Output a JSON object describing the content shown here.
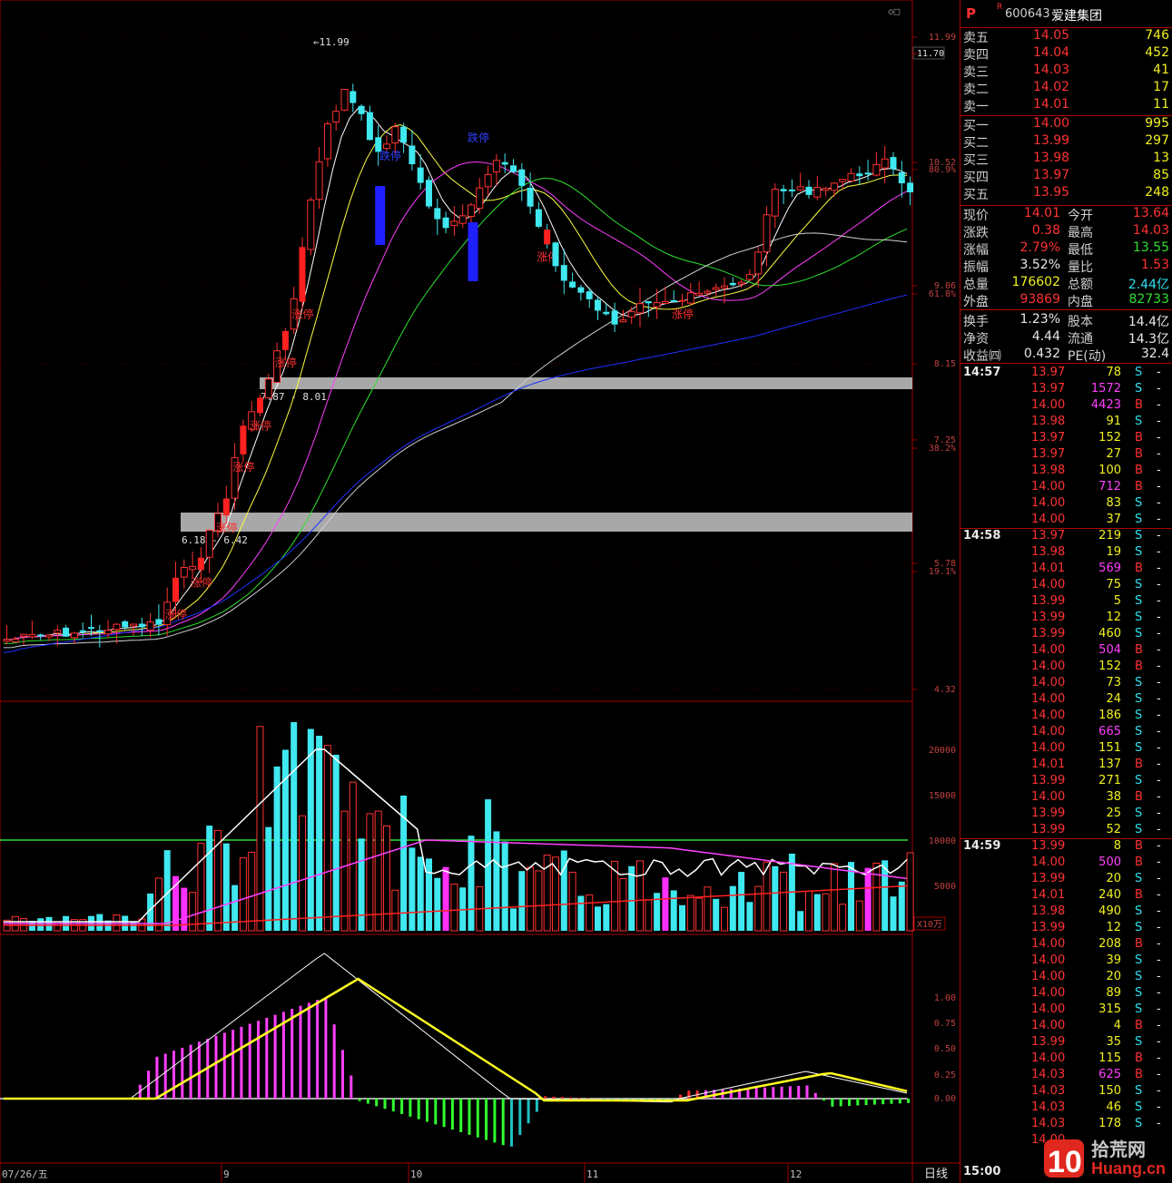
{
  "stock": {
    "flag": "P",
    "mark": "R",
    "code": "600643",
    "name": "爱建集团"
  },
  "quote_book": [
    {
      "label": "卖五",
      "price": "14.05",
      "vol": "746"
    },
    {
      "label": "卖四",
      "price": "14.04",
      "vol": "452"
    },
    {
      "label": "卖三",
      "price": "14.03",
      "vol": "41"
    },
    {
      "label": "卖二",
      "price": "14.02",
      "vol": "17"
    },
    {
      "label": "卖一",
      "price": "14.01",
      "vol": "11"
    },
    {
      "label": "买一",
      "price": "14.00",
      "vol": "995"
    },
    {
      "label": "买二",
      "price": "13.99",
      "vol": "297"
    },
    {
      "label": "买三",
      "price": "13.98",
      "vol": "13"
    },
    {
      "label": "买四",
      "price": "13.97",
      "vol": "85"
    },
    {
      "label": "买五",
      "price": "13.95",
      "vol": "248"
    }
  ],
  "stats": [
    {
      "l1": "现价",
      "v1": "14.01",
      "c1": "red",
      "l2": "今开",
      "v2": "13.64",
      "c2": "red"
    },
    {
      "l1": "涨跌",
      "v1": "0.38",
      "c1": "red",
      "l2": "最高",
      "v2": "14.03",
      "c2": "red"
    },
    {
      "l1": "涨幅",
      "v1": "2.79%",
      "c1": "red",
      "l2": "最低",
      "v2": "13.55",
      "c2": "green"
    },
    {
      "l1": "振幅",
      "v1": "3.52%",
      "c1": "white",
      "l2": "量比",
      "v2": "1.53",
      "c2": "red"
    },
    {
      "l1": "总量",
      "v1": "176602",
      "c1": "yellow",
      "l2": "总额",
      "v2": "2.44亿",
      "c2": "cyan"
    },
    {
      "l1": "外盘",
      "v1": "93869",
      "c1": "red",
      "l2": "内盘",
      "v2": "82733",
      "c2": "green"
    },
    {
      "l1": "换手",
      "v1": "1.23%",
      "c1": "white",
      "l2": "股本",
      "v2": "14.4亿",
      "c2": "white"
    },
    {
      "l1": "净资",
      "v1": "4.44",
      "c1": "white",
      "l2": "流通",
      "v2": "14.3亿",
      "c2": "white"
    },
    {
      "l1": "收益㈣",
      "v1": "0.432",
      "c1": "white",
      "l2": "PE(动)",
      "v2": "32.4",
      "c2": "white"
    }
  ],
  "ticks": [
    {
      "t": "14:57",
      "p": "13.97",
      "v": "78",
      "bs": "S"
    },
    {
      "t": "",
      "p": "13.97",
      "v": "1572",
      "bs": "S"
    },
    {
      "t": "",
      "p": "14.00",
      "v": "4423",
      "bs": "B"
    },
    {
      "t": "",
      "p": "13.98",
      "v": "91",
      "bs": "S"
    },
    {
      "t": "",
      "p": "13.97",
      "v": "152",
      "bs": "B"
    },
    {
      "t": "",
      "p": "13.97",
      "v": "27",
      "bs": "B"
    },
    {
      "t": "",
      "p": "13.98",
      "v": "100",
      "bs": "B"
    },
    {
      "t": "",
      "p": "14.00",
      "v": "712",
      "bs": "B"
    },
    {
      "t": "",
      "p": "14.00",
      "v": "83",
      "bs": "S"
    },
    {
      "t": "",
      "p": "14.00",
      "v": "37",
      "bs": "S"
    },
    {
      "t": "14:58",
      "p": "13.97",
      "v": "219",
      "bs": "S"
    },
    {
      "t": "",
      "p": "13.98",
      "v": "19",
      "bs": "S"
    },
    {
      "t": "",
      "p": "14.01",
      "v": "569",
      "bs": "B"
    },
    {
      "t": "",
      "p": "14.00",
      "v": "75",
      "bs": "S"
    },
    {
      "t": "",
      "p": "13.99",
      "v": "5",
      "bs": "S"
    },
    {
      "t": "",
      "p": "13.99",
      "v": "12",
      "bs": "S"
    },
    {
      "t": "",
      "p": "13.99",
      "v": "460",
      "bs": "S"
    },
    {
      "t": "",
      "p": "14.00",
      "v": "504",
      "bs": "B"
    },
    {
      "t": "",
      "p": "14.00",
      "v": "152",
      "bs": "B"
    },
    {
      "t": "",
      "p": "14.00",
      "v": "73",
      "bs": "S"
    },
    {
      "t": "",
      "p": "14.00",
      "v": "24",
      "bs": "S"
    },
    {
      "t": "",
      "p": "14.00",
      "v": "186",
      "bs": "S"
    },
    {
      "t": "",
      "p": "14.00",
      "v": "665",
      "bs": "S"
    },
    {
      "t": "",
      "p": "14.00",
      "v": "151",
      "bs": "S"
    },
    {
      "t": "",
      "p": "14.01",
      "v": "137",
      "bs": "B"
    },
    {
      "t": "",
      "p": "13.99",
      "v": "271",
      "bs": "S"
    },
    {
      "t": "",
      "p": "14.00",
      "v": "38",
      "bs": "B"
    },
    {
      "t": "",
      "p": "13.99",
      "v": "25",
      "bs": "S"
    },
    {
      "t": "",
      "p": "13.99",
      "v": "52",
      "bs": "S"
    },
    {
      "t": "14:59",
      "p": "13.99",
      "v": "8",
      "bs": "B"
    },
    {
      "t": "",
      "p": "14.00",
      "v": "500",
      "bs": "B"
    },
    {
      "t": "",
      "p": "13.99",
      "v": "20",
      "bs": "S"
    },
    {
      "t": "",
      "p": "14.01",
      "v": "240",
      "bs": "B"
    },
    {
      "t": "",
      "p": "13.98",
      "v": "490",
      "bs": "S"
    },
    {
      "t": "",
      "p": "13.99",
      "v": "12",
      "bs": "S"
    },
    {
      "t": "",
      "p": "14.00",
      "v": "208",
      "bs": "B"
    },
    {
      "t": "",
      "p": "14.00",
      "v": "39",
      "bs": "S"
    },
    {
      "t": "",
      "p": "14.00",
      "v": "20",
      "bs": "S"
    },
    {
      "t": "",
      "p": "14.00",
      "v": "89",
      "bs": "S"
    },
    {
      "t": "",
      "p": "14.00",
      "v": "315",
      "bs": "S"
    },
    {
      "t": "",
      "p": "14.00",
      "v": "4",
      "bs": "B"
    },
    {
      "t": "",
      "p": "13.99",
      "v": "35",
      "bs": "S"
    },
    {
      "t": "",
      "p": "14.00",
      "v": "115",
      "bs": "B"
    },
    {
      "t": "",
      "p": "14.03",
      "v": "625",
      "bs": "B"
    },
    {
      "t": "",
      "p": "14.03",
      "v": "150",
      "bs": "S"
    },
    {
      "t": "",
      "p": "14.03",
      "v": "46",
      "bs": "S"
    },
    {
      "t": "",
      "p": "14.03",
      "v": "178",
      "bs": "S"
    },
    {
      "t": "",
      "p": "14.00",
      "v": "",
      "bs": ""
    }
  ],
  "bottom_time": "15:00",
  "watermark": {
    "num": "10",
    "cn": "拾荒网",
    "en": "Huang.cn"
  },
  "chart": {
    "price_axis": [
      "11.99",
      "11.70",
      "10.52",
      "80.9%",
      "9.06",
      "61.8%",
      "8.15",
      "7.25",
      "38.2%",
      "5.78",
      "19.1%",
      "4.32"
    ],
    "vol_axis": [
      "20000",
      "15000",
      "10000",
      "5000",
      "X10万"
    ],
    "macd_axis": [
      "1.00",
      "0.75",
      "0.50",
      "0.25",
      "0.00"
    ],
    "date_axis": [
      "07/26/五",
      "9",
      "10",
      "11",
      "12",
      "日线"
    ],
    "max_label": "11.99",
    "zone1_label": "7.87 - 8.01",
    "zone2_label": "6.18 - 6.42",
    "zhangting": "涨停",
    "dieting": "跌停",
    "corner_icon": "◇□"
  }
}
